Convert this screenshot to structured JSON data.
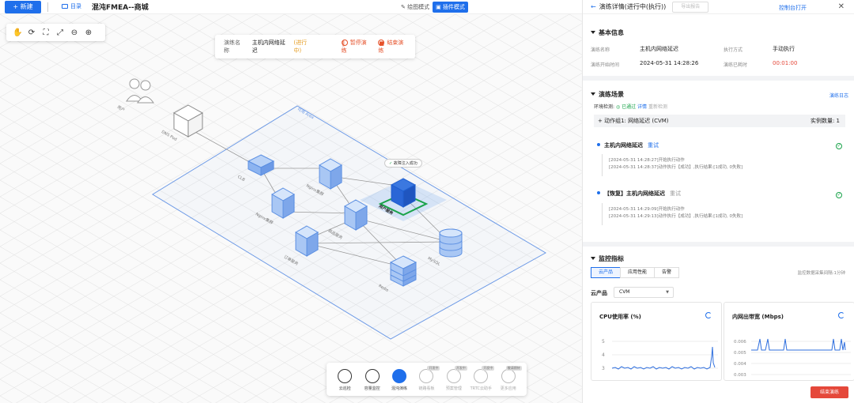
{
  "topbar": {
    "new_label": "新建",
    "dir_label": "目录",
    "title": "混沌FMEA--商城",
    "mode_draw": "绘图模式",
    "mode_plugin": "插件模式"
  },
  "canvas": {
    "infobox": {
      "name_key": "演练名称",
      "name_value": "主机内网络延迟",
      "status": "(进行中)",
      "pause_label": "暂停演练",
      "end_label": "结束演练"
    },
    "region_label": "可用 Area",
    "fault_badge": "故障注入成功",
    "nodes": {
      "user": "用户",
      "dns": "DNS Pod",
      "clb": "CLB",
      "nginx1": "Nginx集群",
      "nginx2": "Nginx集群",
      "user_service": "用户服务",
      "product_service": "商品服务",
      "order_service": "订单服务",
      "mysql": "MySQL",
      "redis": "Redis"
    },
    "dock": [
      {
        "label": "云巡检",
        "state": "normal"
      },
      {
        "label": "容量监控",
        "state": "normal"
      },
      {
        "label": "混沌演练",
        "state": "active"
      },
      {
        "label": "链路看板",
        "state": "disabled",
        "tag": "开发中"
      },
      {
        "label": "预案管理",
        "state": "disabled",
        "tag": "开发中"
      },
      {
        "label": "TRTC云助手",
        "state": "disabled",
        "tag": "开发中"
      },
      {
        "label": "更多应用",
        "state": "disabled",
        "tag": "敬请期待"
      }
    ]
  },
  "panel": {
    "header": {
      "title": "演练详情(进行中(执行))",
      "export_label": "导出报告",
      "console_label": "控制台打开"
    },
    "basic": {
      "title": "基本信息",
      "name_key": "演练名称",
      "name_value": "主机内网络延迟",
      "mode_key": "执行方式",
      "mode_value": "手动执行",
      "start_key": "演练开始时间",
      "start_value": "2024-05-31 14:28:26",
      "elapsed_key": "演练已耗时",
      "elapsed_value": "00:01:00"
    },
    "scene": {
      "title": "演练场景",
      "log_link": "演练日志",
      "env_key": "环境检测:",
      "env_status": "已通过",
      "env_detail": "详情",
      "env_recheck": "重新检测",
      "group_label": "+ 动作组1:  网络延迟  (CVM)",
      "count_label": "实例数量:  1",
      "actions": [
        {
          "name": "主机内网络延迟",
          "retry": "重试",
          "logs": [
            "[2024-05-31 14:28:27]开始执行动作",
            "[2024-05-31 14:28:37]动作执行【成功】,执行结果:[1成功, 0失败]"
          ]
        },
        {
          "name": "【恢复】主机内网络延迟",
          "retry": "重试",
          "logs": [
            "[2024-05-31 14:29:09]开始执行动作",
            "[2024-05-31 14:29:13]动作执行【成功】,执行结果:[1成功, 0失败]"
          ]
        }
      ]
    },
    "monitor": {
      "title": "监控指标",
      "tabs": [
        "云产品",
        "应用性能",
        "告警"
      ],
      "interval": "监控数据采集间隔:1分钟",
      "cloud_label": "云产品",
      "select_value": "CVM",
      "cards": [
        {
          "title": "CPU使用率 (%)",
          "ticks": [
            "5",
            "4",
            "3"
          ]
        },
        {
          "title": "内网出带宽 (Mbps)",
          "ticks": [
            "0.006",
            "0.005",
            "0.004",
            "0.003"
          ]
        }
      ]
    },
    "end_label": "结束演练"
  }
}
